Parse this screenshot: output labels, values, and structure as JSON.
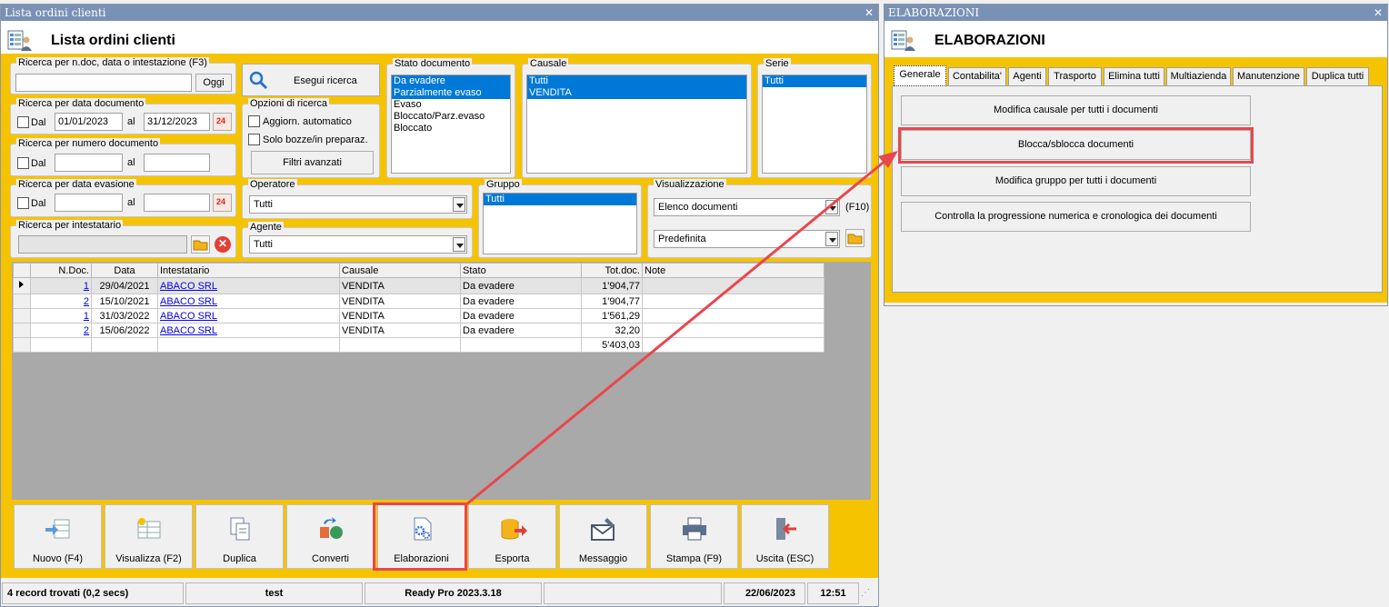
{
  "main": {
    "window_title": "Lista ordini clienti",
    "header_title": "Lista ordini clienti",
    "search": {
      "ndoc_label": "Ricerca per n.doc, data o intestazione (F3)",
      "ndoc_value": "",
      "oggi_label": "Oggi",
      "data_doc_label": "Ricerca per data documento",
      "dal_label": "Dal",
      "al_label": "al",
      "data_from": "01/01/2023",
      "data_to": "31/12/2023",
      "num_doc_label": "Ricerca per numero documento",
      "evasione_label": "Ricerca per data evasione",
      "intestatario_label": "Ricerca per intestatario",
      "calendar_text": "24",
      "esegui_label": "Esegui ricerca",
      "opzioni_label": "Opzioni di ricerca",
      "aggiorn_label": "Aggiorn. automatico",
      "bozze_label": "Solo bozze/in preparaz.",
      "filtri_label": "Filtri avanzati",
      "operatore_label": "Operatore",
      "operatore_value": "Tutti",
      "agente_label": "Agente",
      "agente_value": "Tutti"
    },
    "stato_documento": {
      "label": "Stato documento",
      "items": [
        {
          "text": "Da evadere",
          "selected": true
        },
        {
          "text": "Parzialmente evaso",
          "selected": true
        },
        {
          "text": "Evaso",
          "selected": false
        },
        {
          "text": "Bloccato/Parz.evaso",
          "selected": false
        },
        {
          "text": "Bloccato",
          "selected": false
        }
      ]
    },
    "causale": {
      "label": "Causale",
      "items": [
        {
          "text": "Tutti",
          "selected": true
        },
        {
          "text": "VENDITA",
          "selected": true
        }
      ]
    },
    "serie": {
      "label": "Serie",
      "items": [
        {
          "text": "Tutti",
          "selected": true
        }
      ]
    },
    "gruppo": {
      "label": "Gruppo",
      "items": [
        {
          "text": "Tutti",
          "selected": true
        }
      ]
    },
    "visualizzazione": {
      "label": "Visualizzazione",
      "value1": "Elenco documenti",
      "shortcut": "(F10)",
      "value2": "Predefinita"
    },
    "table": {
      "columns": [
        "N.Doc.",
        "Data",
        "Intestatario",
        "Causale",
        "Stato",
        "Tot.doc.",
        "Note"
      ],
      "rows": [
        {
          "ndoc": "1",
          "data": "29/04/2021",
          "intestatario": "ABACO SRL",
          "causale": "VENDITA",
          "stato": "Da evadere",
          "tot": "1'904,77",
          "note": ""
        },
        {
          "ndoc": "2",
          "data": "15/10/2021",
          "intestatario": "ABACO SRL",
          "causale": "VENDITA",
          "stato": "Da evadere",
          "tot": "1'904,77",
          "note": ""
        },
        {
          "ndoc": "1",
          "data": "31/03/2022",
          "intestatario": "ABACO SRL",
          "causale": "VENDITA",
          "stato": "Da evadere",
          "tot": "1'561,29",
          "note": ""
        },
        {
          "ndoc": "2",
          "data": "15/06/2022",
          "intestatario": "ABACO SRL",
          "causale": "VENDITA",
          "stato": "Da evadere",
          "tot": "32,20",
          "note": ""
        }
      ],
      "total": "5'403,03"
    },
    "toolbar": {
      "nuovo": "Nuovo (F4)",
      "visualizza": "Visualizza (F2)",
      "duplica": "Duplica",
      "converti": "Converti",
      "elaborazioni": "Elaborazioni",
      "esporta": "Esporta",
      "messaggio": "Messaggio",
      "stampa": "Stampa (F9)",
      "uscita": "Uscita (ESC)"
    },
    "status": {
      "records": "4 record trovati (0,2 secs)",
      "user": "test",
      "version": "Ready Pro 2023.3.18",
      "date": "22/06/2023",
      "time": "12:51"
    }
  },
  "elaborazioni": {
    "window_title": "ELABORAZIONI",
    "header_title": "ELABORAZIONI",
    "tabs": [
      "Generale",
      "Contabilita'",
      "Agenti",
      "Trasporto",
      "Elimina tutti",
      "Multiazienda",
      "Manutenzione",
      "Duplica tutti"
    ],
    "buttons": [
      "Modifica causale per tutti i documenti",
      "Blocca/sblocca documenti",
      "Modifica gruppo per tutti i documenti",
      "Controlla la progressione numerica e cronologica dei documenti"
    ]
  },
  "colors": {
    "titlebar": "#7891b5",
    "yellow": "#f6c300",
    "selection": "#0078d7",
    "highlight": "#e8474c"
  }
}
